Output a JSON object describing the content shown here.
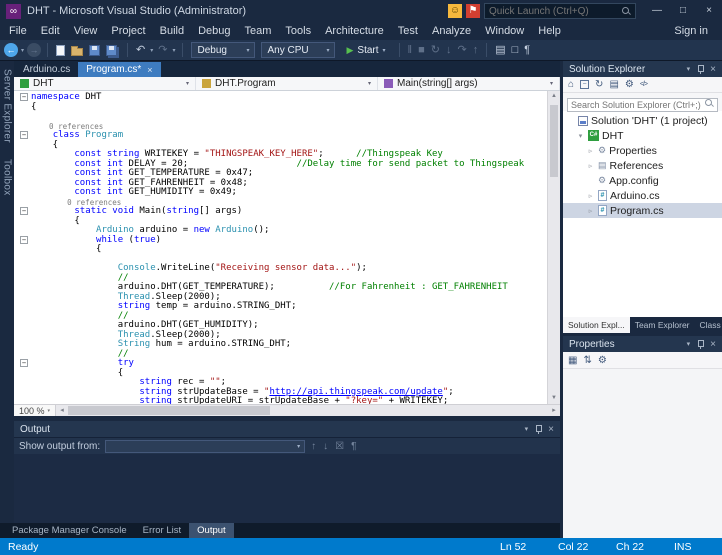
{
  "window": {
    "title": "DHT - Microsoft Visual Studio (Administrator)",
    "sign_in": "Sign in",
    "quick_launch_placeholder": "Quick Launch (Ctrl+Q)"
  },
  "menu": {
    "items": [
      "File",
      "Edit",
      "View",
      "Project",
      "Build",
      "Debug",
      "Team",
      "Tools",
      "Architecture",
      "Test",
      "Analyze",
      "Window",
      "Help"
    ]
  },
  "toolbar": {
    "configuration": "Debug",
    "platform": "Any CPU",
    "start_label": "Start"
  },
  "side_tabs": {
    "items": [
      "Server Explorer",
      "Toolbox"
    ]
  },
  "editor": {
    "tabs": [
      {
        "label": "Arduino.cs",
        "active": false
      },
      {
        "label": "Program.cs*",
        "active": true
      }
    ],
    "navigation": {
      "project": "DHT",
      "type": "DHT.Program",
      "member": "Main(string[] args)"
    },
    "zoom": "100 %",
    "code": {
      "lines": [
        {
          "f": 1,
          "t": [
            [
              "k",
              "namespace"
            ],
            [
              "p",
              " DHT"
            ]
          ]
        },
        {
          "t": [
            [
              "p",
              "{"
            ]
          ]
        },
        {
          "t": [
            [
              "p",
              ""
            ]
          ]
        },
        {
          "t": [
            [
              "cl",
              "    0 references"
            ]
          ]
        },
        {
          "f": 1,
          "t": [
            [
              "p",
              "    "
            ],
            [
              "k",
              "class"
            ],
            [
              "p",
              " "
            ],
            [
              "t",
              "Program"
            ]
          ]
        },
        {
          "t": [
            [
              "p",
              "    {"
            ]
          ]
        },
        {
          "t": [
            [
              "p",
              "        "
            ],
            [
              "k",
              "const string"
            ],
            [
              "p",
              " WRITEKEY = "
            ],
            [
              "s",
              "\"THINGSPEAK_KEY_HERE\""
            ],
            [
              "p",
              ";      "
            ],
            [
              "c",
              "//Thingspeak Key"
            ]
          ]
        },
        {
          "t": [
            [
              "p",
              "        "
            ],
            [
              "k",
              "const int"
            ],
            [
              "p",
              " DELAY = 20;                    "
            ],
            [
              "c",
              "//Delay time for send packet to Thingspeak"
            ]
          ]
        },
        {
          "t": [
            [
              "p",
              "        "
            ],
            [
              "k",
              "const int"
            ],
            [
              "p",
              " GET_TEMPERATURE = 0x47;"
            ]
          ]
        },
        {
          "t": [
            [
              "p",
              "        "
            ],
            [
              "k",
              "const int"
            ],
            [
              "p",
              " GET_FAHRENHEIT = 0x48;"
            ]
          ]
        },
        {
          "t": [
            [
              "p",
              "        "
            ],
            [
              "k",
              "const int"
            ],
            [
              "p",
              " GET_HUMIDITY = 0x49;"
            ]
          ]
        },
        {
          "t": [
            [
              "cl",
              "        0 references"
            ]
          ]
        },
        {
          "f": 1,
          "t": [
            [
              "p",
              "        "
            ],
            [
              "k",
              "static void"
            ],
            [
              "p",
              " Main("
            ],
            [
              "k",
              "string"
            ],
            [
              "p",
              "[] args)"
            ]
          ]
        },
        {
          "t": [
            [
              "p",
              "        {"
            ]
          ]
        },
        {
          "t": [
            [
              "p",
              "            "
            ],
            [
              "t",
              "Arduino"
            ],
            [
              "p",
              " arduino = "
            ],
            [
              "k",
              "new"
            ],
            [
              "p",
              " "
            ],
            [
              "t",
              "Arduino"
            ],
            [
              "p",
              "();"
            ]
          ]
        },
        {
          "f": 1,
          "t": [
            [
              "p",
              "            "
            ],
            [
              "k",
              "while"
            ],
            [
              "p",
              " ("
            ],
            [
              "k",
              "true"
            ],
            [
              "p",
              ")"
            ]
          ]
        },
        {
          "t": [
            [
              "p",
              "            {"
            ]
          ]
        },
        {
          "t": [
            [
              "p",
              ""
            ]
          ]
        },
        {
          "t": [
            [
              "p",
              "                "
            ],
            [
              "t",
              "Console"
            ],
            [
              "p",
              ".WriteLine("
            ],
            [
              "s",
              "\"Receiving sensor data...\""
            ],
            [
              "p",
              ");"
            ]
          ]
        },
        {
          "t": [
            [
              "p",
              "                "
            ],
            [
              "c",
              "//"
            ]
          ]
        },
        {
          "t": [
            [
              "p",
              "                arduino.DHT(GET_TEMPERATURE);          "
            ],
            [
              "c",
              "//For Fahrenheit : GET_FAHRENHEIT"
            ]
          ]
        },
        {
          "t": [
            [
              "p",
              "                "
            ],
            [
              "t",
              "Thread"
            ],
            [
              "p",
              ".Sleep(2000);"
            ]
          ]
        },
        {
          "t": [
            [
              "p",
              "                "
            ],
            [
              "k",
              "string"
            ],
            [
              "p",
              " temp = arduino.STRING_DHT;"
            ]
          ]
        },
        {
          "t": [
            [
              "p",
              "                "
            ],
            [
              "c",
              "//"
            ]
          ]
        },
        {
          "t": [
            [
              "p",
              "                arduino.DHT(GET_HUMIDITY);"
            ]
          ]
        },
        {
          "t": [
            [
              "p",
              "                "
            ],
            [
              "t",
              "Thread"
            ],
            [
              "p",
              ".Sleep(2000);"
            ]
          ]
        },
        {
          "t": [
            [
              "p",
              "                "
            ],
            [
              "t",
              "String"
            ],
            [
              "p",
              " hum = arduino.STRING_DHT;"
            ]
          ]
        },
        {
          "t": [
            [
              "p",
              "                "
            ],
            [
              "c",
              "//"
            ]
          ]
        },
        {
          "f": 1,
          "t": [
            [
              "p",
              "                "
            ],
            [
              "k",
              "try"
            ]
          ]
        },
        {
          "t": [
            [
              "p",
              "                {"
            ]
          ]
        },
        {
          "t": [
            [
              "p",
              "                    "
            ],
            [
              "k",
              "string"
            ],
            [
              "p",
              " rec = "
            ],
            [
              "s",
              "\"\""
            ],
            [
              "p",
              ";"
            ]
          ]
        },
        {
          "t": [
            [
              "p",
              "                    "
            ],
            [
              "k",
              "string"
            ],
            [
              "p",
              " strUpdateBase = "
            ],
            [
              "s",
              "\""
            ],
            [
              "u",
              "http://api.thingspeak.com/update"
            ],
            [
              "s",
              "\""
            ],
            [
              "p",
              ";"
            ]
          ]
        },
        {
          "t": [
            [
              "p",
              "                    "
            ],
            [
              "k",
              "string"
            ],
            [
              "p",
              " strUpdateURI = strUpdateBase + "
            ],
            [
              "s",
              "\"?key=\""
            ],
            [
              "p",
              " + WRITEKEY;"
            ]
          ]
        }
      ]
    }
  },
  "output": {
    "title": "Output",
    "show_output_from_label": "Show output from:",
    "dropdown_value": ""
  },
  "bottom_tabs": {
    "items": [
      {
        "label": "Package Manager Console",
        "active": false
      },
      {
        "label": "Error List",
        "active": false
      },
      {
        "label": "Output",
        "active": true
      }
    ]
  },
  "status_bar": {
    "state": "Ready",
    "line": "Ln 52",
    "column": "Col 22",
    "character": "Ch 22",
    "mode": "INS"
  },
  "solution_explorer": {
    "title": "Solution Explorer",
    "search_placeholder": "Search Solution Explorer (Ctrl+;)",
    "tree": [
      {
        "label": "Solution 'DHT' (1 project)",
        "indent": 0,
        "icon": "solution",
        "arrow": "none",
        "selected": false
      },
      {
        "label": "DHT",
        "indent": 1,
        "icon": "csharp-project",
        "arrow": "expanded",
        "selected": false
      },
      {
        "label": "Properties",
        "indent": 2,
        "icon": "properties",
        "arrow": "collapsed",
        "selected": false
      },
      {
        "label": "References",
        "indent": 2,
        "icon": "references",
        "arrow": "collapsed",
        "selected": false
      },
      {
        "label": "App.config",
        "indent": 2,
        "icon": "config",
        "arrow": "none",
        "selected": false
      },
      {
        "label": "Arduino.cs",
        "indent": 2,
        "icon": "csharp-file",
        "arrow": "collapsed",
        "selected": false
      },
      {
        "label": "Program.cs",
        "indent": 2,
        "icon": "csharp-file",
        "arrow": "collapsed",
        "selected": true
      }
    ],
    "bottom_tabs": [
      {
        "label": "Solution Expl...",
        "active": true
      },
      {
        "label": "Team Explorer",
        "active": false
      },
      {
        "label": "Class View",
        "active": false
      }
    ]
  },
  "properties_panel": {
    "title": "Properties"
  },
  "icons": {
    "vs_logo": "∞",
    "feedback": "☺",
    "notifications": "⚑",
    "minimize": "—",
    "maximize": "□",
    "close": "×",
    "back": "←",
    "forward": "→",
    "undo": "↶",
    "redo": "↷",
    "start_arrow": "▶",
    "combo_arrow": "▾",
    "break_all": "‖",
    "stop": "■",
    "restart": "↻",
    "step_into": "↓",
    "step_over": "↷",
    "step_out": "↑",
    "window_position": "▾",
    "scroll_up": "▲",
    "scroll_down": "▼",
    "scroll_left": "◂",
    "scroll_right": "▸",
    "home": "⌂",
    "refresh": "↻",
    "show_all_files": "▤",
    "gear": "⚙",
    "messages": "▤",
    "prev_message": "↑",
    "next_message": "↓",
    "clear_all": "☒",
    "word_wrap": "¶",
    "categorized": "▦",
    "alphabetical": "⇅",
    "expanded": "▾",
    "collapsed": "▹",
    "fold_collapse": "−"
  },
  "colors": {
    "chrome": "#1a2940",
    "toolbar": "#22344e",
    "active_tab": "#3e7cc0",
    "status_bar": "#007acc",
    "start_green": "#57c04f",
    "keyword": "#0000ff",
    "type": "#2b91af",
    "string": "#a31515",
    "comment": "#008000",
    "codelens": "#7d7d7d"
  }
}
